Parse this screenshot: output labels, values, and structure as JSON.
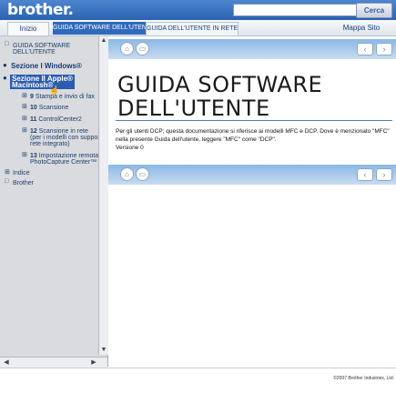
{
  "header": {
    "logo": "brother.",
    "search": {
      "value": "",
      "placeholder": "",
      "button_label": "Cerca"
    }
  },
  "nav": {
    "home": "Inizio",
    "tab_active": "GUIDA SOFTWARE DELL'UTENTE",
    "tab_rete": "GUIDA DELL'UTENTE IN RETE",
    "site_map": "Mappa Sito"
  },
  "sidebar": {
    "root": "GUIDA SOFTWARE\nDELL'UTENTE",
    "sezione_windows": "Sezione I Windows®",
    "sezione_apple": "Sezione II Apple®\nMacintosh®",
    "items": [
      {
        "num": "9",
        "label": "Stampa e invio di fax"
      },
      {
        "num": "10",
        "label": "Scansione"
      },
      {
        "num": "11",
        "label": "ControlCenter2"
      },
      {
        "num": "12",
        "label": "Scansione in rete\n(per i modelli con supporto\nrete integrato)"
      },
      {
        "num": "13",
        "label": "Impostazione remota e\nPhotoCapture Center™"
      }
    ],
    "indice": "Indice",
    "brother": "Brother"
  },
  "main": {
    "title_line1": "GUIDA SOFTWARE",
    "title_line2": "DELL'UTENTE",
    "intro": "Per gli utenti DCP; questa documentazione si riferisce ai modelli MFC e DCP. Dove è menzionato \"MFC\" nella presente Guida dell'utente, leggere \"MFC\" come \"DCP\".",
    "version": "Versione 0"
  },
  "footer": {
    "copyright": "©2007 Brother Industries, Ltd."
  },
  "icons": {
    "home": "home-icon",
    "print": "print-icon",
    "prev": "prev-arrow-icon",
    "next": "next-arrow-icon"
  },
  "colors": {
    "header_blue": "#2b62b0",
    "band_blue": "#8bb7e6",
    "sidebar_gray": "#d9dbde",
    "selected": "#2b5cad"
  }
}
